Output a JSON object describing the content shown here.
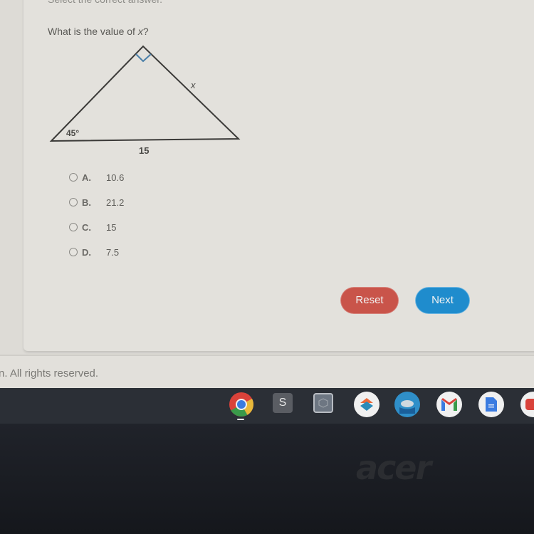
{
  "page": {
    "instruction": "Select the correct answer.",
    "question_prefix": "What is the value of ",
    "question_var": "x",
    "question_suffix": "?"
  },
  "figure": {
    "type": "right-triangle",
    "angle_label": "45°",
    "base_label": "15",
    "side_label": "x",
    "right_angle_marker_color": "#4a7fa8"
  },
  "choices": [
    {
      "letter": "A.",
      "value": "10.6"
    },
    {
      "letter": "B.",
      "value": "21.2"
    },
    {
      "letter": "C.",
      "value": "15"
    },
    {
      "letter": "D.",
      "value": "7.5"
    }
  ],
  "buttons": {
    "reset_label": "Reset",
    "next_label": "Next",
    "reset_color": "#c9544a",
    "next_color": "#1f8ccd"
  },
  "footer": {
    "copyright": "n. All rights reserved."
  },
  "taskbar": {
    "apps": [
      {
        "name": "chrome",
        "active": true
      },
      {
        "name": "s-app",
        "label": "S"
      },
      {
        "name": "cube-app"
      },
      {
        "name": "layers-app"
      },
      {
        "name": "boat-app"
      },
      {
        "name": "gmail"
      },
      {
        "name": "google-docs"
      },
      {
        "name": "youtube"
      }
    ]
  },
  "device": {
    "brand": "acer"
  }
}
